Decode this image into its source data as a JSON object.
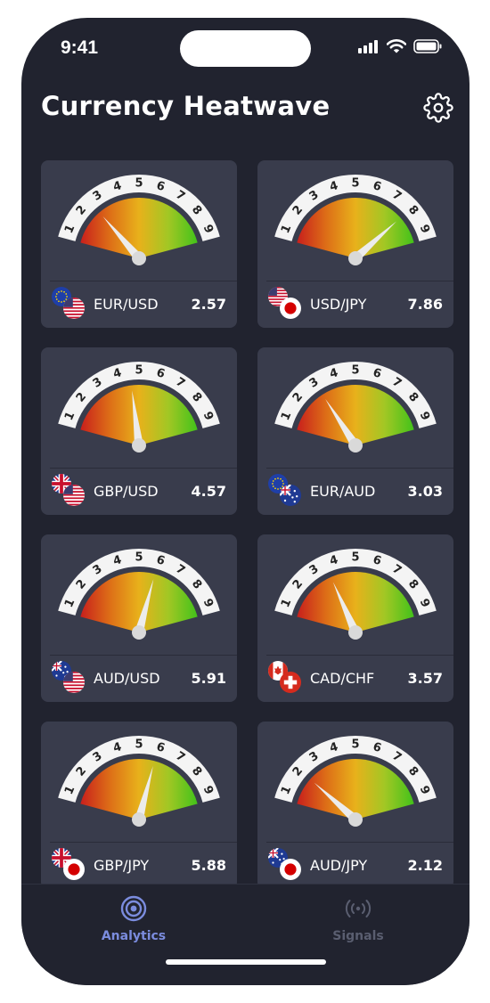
{
  "status_bar": {
    "time": "9:41"
  },
  "header": {
    "title": "Currency Heatwave",
    "settings_icon": "gear-icon"
  },
  "gauge": {
    "scale": [
      "1",
      "2",
      "3",
      "4",
      "5",
      "6",
      "7",
      "8",
      "9"
    ],
    "min": 1,
    "max": 9,
    "colors": [
      "#c81f1c",
      "#dd6e17",
      "#e8b11b",
      "#a2c724",
      "#42c21a"
    ]
  },
  "pairs": [
    {
      "pair": "EUR/USD",
      "value": "2.57",
      "level": 2.57,
      "flags": [
        "eu",
        "us"
      ]
    },
    {
      "pair": "USD/JPY",
      "value": "7.86",
      "level": 7.86,
      "flags": [
        "us",
        "jp"
      ]
    },
    {
      "pair": "GBP/USD",
      "value": "4.57",
      "level": 4.57,
      "flags": [
        "gb",
        "us"
      ]
    },
    {
      "pair": "EUR/AUD",
      "value": "3.03",
      "level": 3.03,
      "flags": [
        "eu",
        "au"
      ]
    },
    {
      "pair": "AUD/USD",
      "value": "5.91",
      "level": 5.91,
      "flags": [
        "au",
        "us"
      ]
    },
    {
      "pair": "CAD/CHF",
      "value": "3.57",
      "level": 3.57,
      "flags": [
        "ca",
        "ch"
      ]
    },
    {
      "pair": "GBP/JPY",
      "value": "5.88",
      "level": 5.88,
      "flags": [
        "gb",
        "jp"
      ]
    },
    {
      "pair": "AUD/JPY",
      "value": "2.12",
      "level": 2.12,
      "flags": [
        "au",
        "jp"
      ]
    }
  ],
  "tabs": {
    "analytics": {
      "label": "Analytics",
      "icon": "target-icon",
      "active": true,
      "color": "#7b8cde"
    },
    "signals": {
      "label": "Signals",
      "icon": "broadcast-icon",
      "active": false,
      "color": "#5a5e70"
    }
  }
}
